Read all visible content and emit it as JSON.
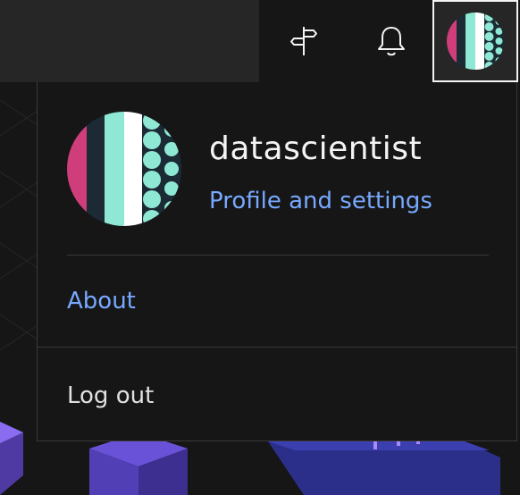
{
  "header": {
    "icons": {
      "guide": "signpost-icon",
      "notifications": "bell-icon",
      "avatar": "user-avatar"
    }
  },
  "user_menu": {
    "username": "datascientist",
    "profile_link": "Profile and settings",
    "about_label": "About",
    "logout_label": "Log out"
  },
  "colors": {
    "link": "#78a9ff",
    "text": "#f4f4f4",
    "avatar_pink": "#cf3d7a",
    "avatar_dark": "#1b2a35",
    "avatar_teal": "#8fe8d4",
    "avatar_white": "#ffffff"
  }
}
